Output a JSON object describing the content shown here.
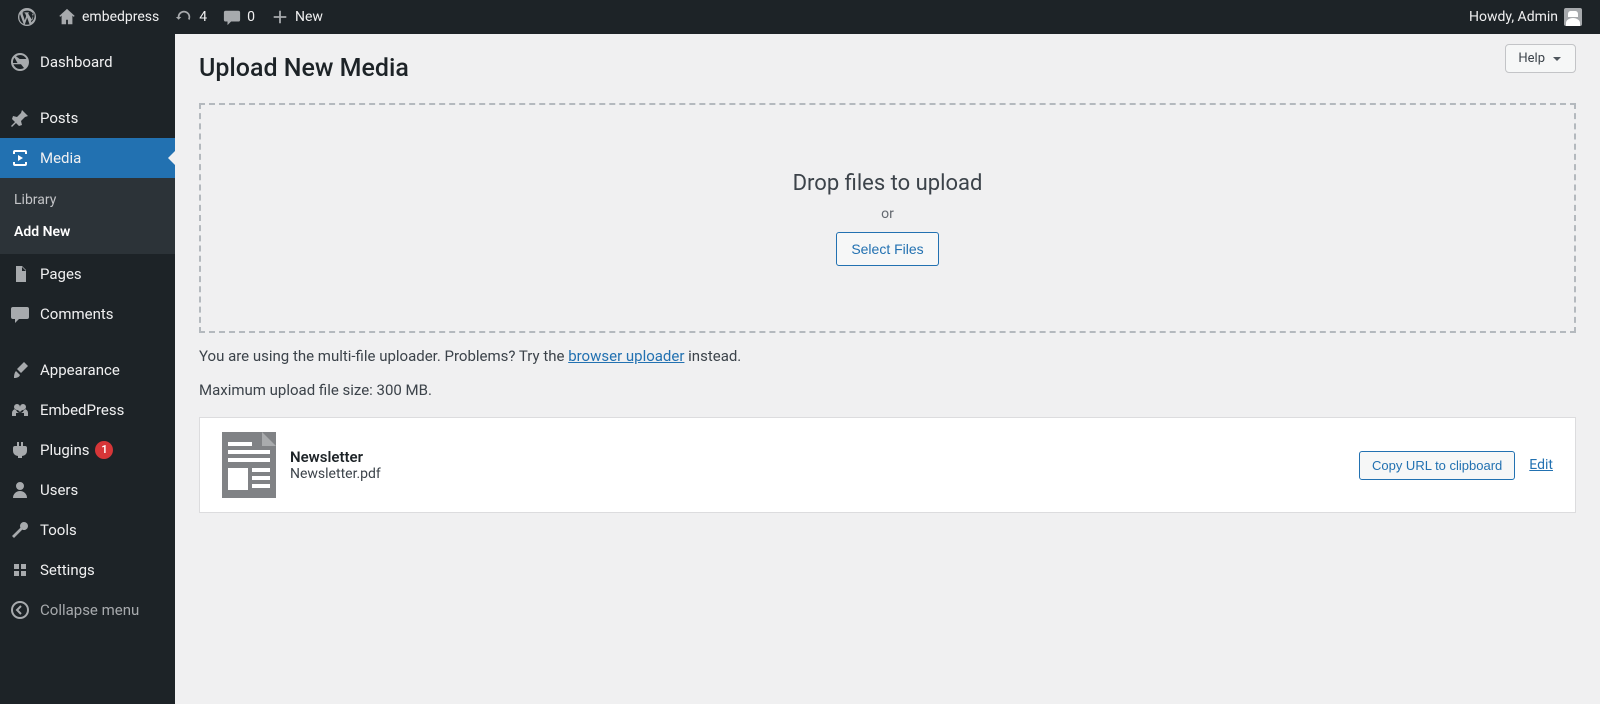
{
  "adminbar": {
    "site_name": "embedpress",
    "updates_count": "4",
    "comments_count": "0",
    "new_label": "New",
    "howdy": "Howdy, Admin"
  },
  "sidebar": {
    "dashboard": "Dashboard",
    "posts": "Posts",
    "media": "Media",
    "media_sub": {
      "library": "Library",
      "add_new": "Add New"
    },
    "pages": "Pages",
    "comments": "Comments",
    "appearance": "Appearance",
    "embedpress": "EmbedPress",
    "plugins": "Plugins",
    "plugins_badge": "1",
    "users": "Users",
    "tools": "Tools",
    "settings": "Settings",
    "collapse": "Collapse menu"
  },
  "main": {
    "help": "Help",
    "page_title": "Upload New Media",
    "drop": {
      "primary": "Drop files to upload",
      "or": "or",
      "select": "Select Files"
    },
    "notes_prefix": "You are using the multi-file uploader. Problems? Try the ",
    "notes_link": "browser uploader",
    "notes_suffix": " instead.",
    "max_size": "Maximum upload file size: 300 MB.",
    "upload": {
      "title": "Newsletter",
      "filename": "Newsletter.pdf",
      "copy": "Copy URL to clipboard",
      "edit": "Edit"
    }
  }
}
